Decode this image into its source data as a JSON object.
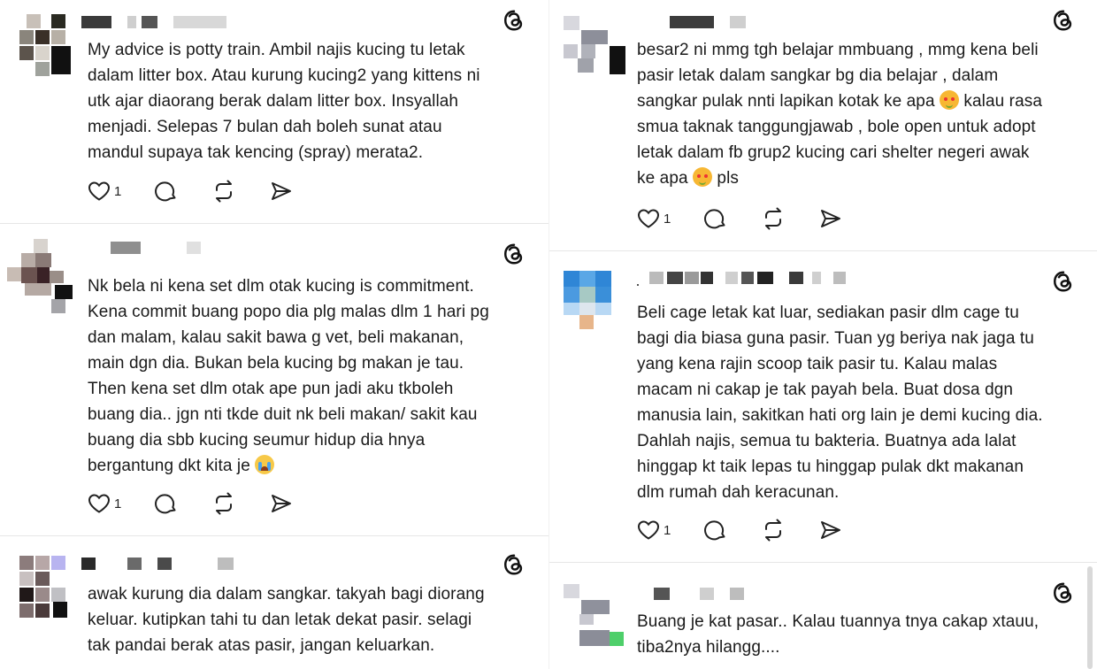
{
  "icons": {
    "threads": "threads-logo-icon",
    "like": "heart-outline-icon",
    "reply": "comment-bubble-icon",
    "repost": "repost-icon",
    "share": "send-icon"
  },
  "emoji": {
    "smiling_hearts": "smiling-face-with-hearts-emoji",
    "crying": "loudly-crying-face-emoji"
  },
  "left_posts": [
    {
      "text": "My advice is potty train. Ambil najis kucing tu letak\ndalam litter box. Atau kurung kucing2 yang kittens ni\nutk ajar diaorang berak dalam litter box. Insyallah\nmenjadi. Selepas 7 bulan dah boleh sunat atau\nmandul supaya tak kencing (spray) merata2.",
      "like_count": "1"
    },
    {
      "text_before_emoji": "Nk bela ni kena set dlm otak kucing is commitment.\nKena commit buang popo dia plg malas dlm 1 hari pg\ndan malam, kalau sakit bawa g vet, beli makanan,\nmain dgn dia. Bukan bela kucing bg makan je tau.\nThen kena set dlm otak ape pun jadi aku tkboleh\nbuang dia.. jgn nti tkde duit nk beli makan/ sakit kau\nbuang dia sbb kucing seumur hidup dia hnya\nbergantung dkt kita je ",
      "like_count": "1"
    },
    {
      "text": "awak kurung dia dalam sangkar. takyah bagi diorang\nkeluar. kutipkan tahi tu dan letak dekat pasir. selagi\ntak pandai berak atas pasir, jangan keluarkan."
    }
  ],
  "right_posts": [
    {
      "line1": "besar2 ni mmg tgh belajar mmbuang , mmg kena beli",
      "line2": "pasir letak dalam sangkar bg dia belajar , dalam",
      "line3_a": "sangkar pulak nnti lapikan kotak ke apa ",
      "line3_b": " kalau rasa",
      "line4": "smua taknak tanggungjawab , bole open untuk adopt",
      "line5": "letak dalam fb grup2 kucing cari shelter negeri awak",
      "line6_a": "ke apa ",
      "line6_b": " pls",
      "like_count": "1"
    },
    {
      "text": "Beli cage letak kat luar, sediakan pasir dlm cage tu\nbagi dia biasa guna pasir. Tuan yg beriya nak jaga tu\nyang kena rajin scoop taik pasir tu. Kalau malas\nmacam ni cakap je tak payah bela. Buat dosa dgn\nmanusia lain, sakitkan hati org lain je demi kucing dia.\nDahlah najis, semua tu bakteria. Buatnya ada lalat\nhinggap kt taik lepas tu hinggap pulak dkt makanan\ndlm rumah dah keracunan.",
      "like_count": "1"
    },
    {
      "text": "Buang je kat pasar.. Kalau tuannya tnya cakap xtauu,\ntiba2nya hilangg...."
    }
  ]
}
